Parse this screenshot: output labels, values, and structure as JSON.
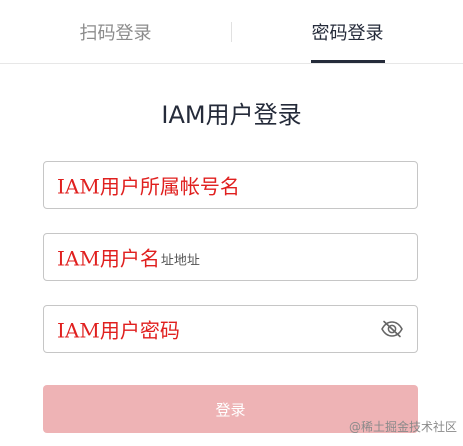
{
  "tabs": {
    "qr_label": "扫码登录",
    "password_label": "密码登录"
  },
  "title": "IAM用户登录",
  "fields": {
    "account_label": "IAM用户所属帐号名",
    "user_label": "IAM用户名",
    "user_suffix": "址地址",
    "password_label": "IAM用户密码",
    "password_icon": "eye-slash-icon"
  },
  "login_button": "登录",
  "watermark": "@稀土掘金技术社区",
  "colors": {
    "label_red": "#e0201f",
    "button_bg": "#eeb3b5",
    "active_tab": "#252b3a"
  }
}
